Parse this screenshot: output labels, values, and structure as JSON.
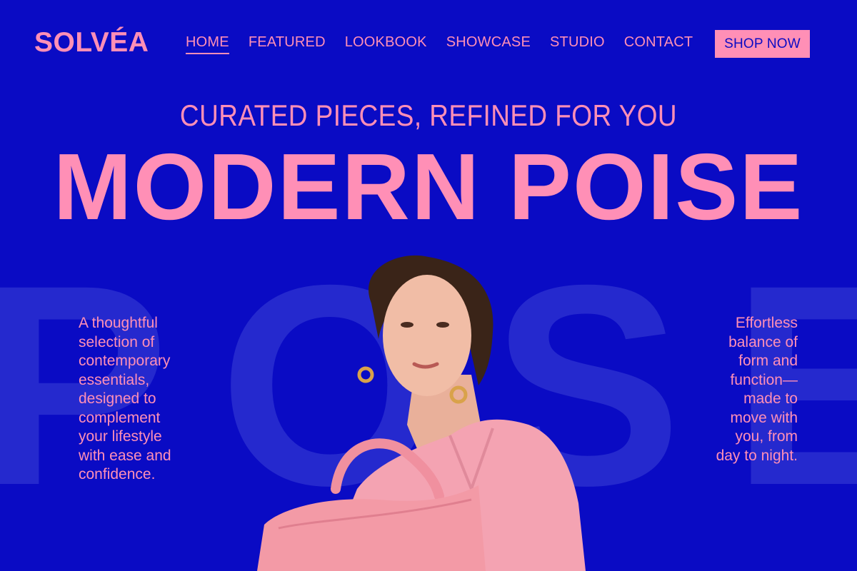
{
  "header": {
    "logo": "SOLVÉA",
    "nav": [
      {
        "label": "HOME",
        "active": true
      },
      {
        "label": "FEATURED",
        "active": false
      },
      {
        "label": "LOOKBOOK",
        "active": false
      },
      {
        "label": "SHOWCASE",
        "active": false
      },
      {
        "label": "STUDIO",
        "active": false
      },
      {
        "label": "CONTACT",
        "active": false
      }
    ],
    "cta": "SHOP NOW"
  },
  "hero": {
    "subtitle": "CURATED PIECES, REFINED FOR YOU",
    "headline": "MODERN POISE",
    "background_word": "POSE",
    "left_copy": "A thoughtful selection of contemporary essentials, designed to complement your lifestyle with ease and confidence.",
    "right_copy": "Effortless balance of form and function—made to move with you, from day to night."
  },
  "colors": {
    "background": "#0a0bc4",
    "accent": "#ff8fb6"
  },
  "image": {
    "subject": "model-in-pink-blazer-with-pink-handbag"
  }
}
